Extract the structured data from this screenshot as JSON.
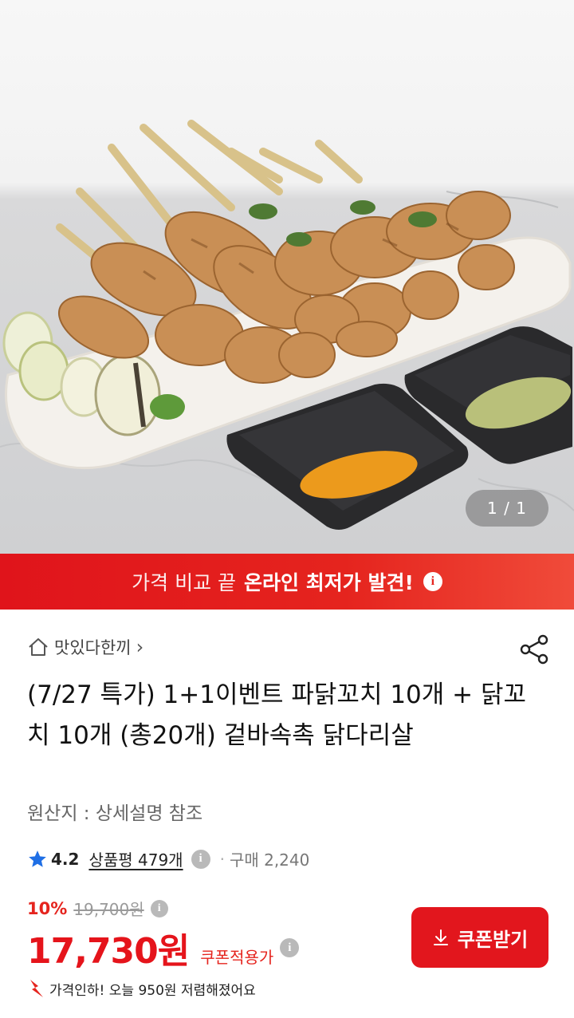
{
  "hero": {
    "image_counter": "1 / 1",
    "image_alt": "파닭꼬치 닭꼬치 접시 사진"
  },
  "banner": {
    "light_text": "가격 비교 끝",
    "bold_text": "온라인 최저가 발견!",
    "info_icon": "info-icon"
  },
  "store": {
    "icon": "home-icon",
    "name": "맛있다한끼",
    "chevron": "›"
  },
  "product": {
    "title": "(7/27 특가) 1+1이벤트 파닭꼬치 10개 + 닭꼬치 10개 (총20개) 겉바속촉 닭다리살",
    "origin": "원산지 : 상세설명 참조"
  },
  "rating": {
    "score": "4.2",
    "reviews": "상품평 479개",
    "purchases": "구매 2,240"
  },
  "price": {
    "discount_pct": "10%",
    "original_price": "19,700원",
    "final_price": "17,730원",
    "coupon_label": "쿠폰적용가",
    "notice": "가격인하! 오늘 950원 저렴해졌어요"
  },
  "buttons": {
    "coupon": "쿠폰받기"
  },
  "colors": {
    "brand_red": "#e2161d",
    "banner_red": "#e5241e",
    "muted_grey": "#9a9a9a"
  }
}
